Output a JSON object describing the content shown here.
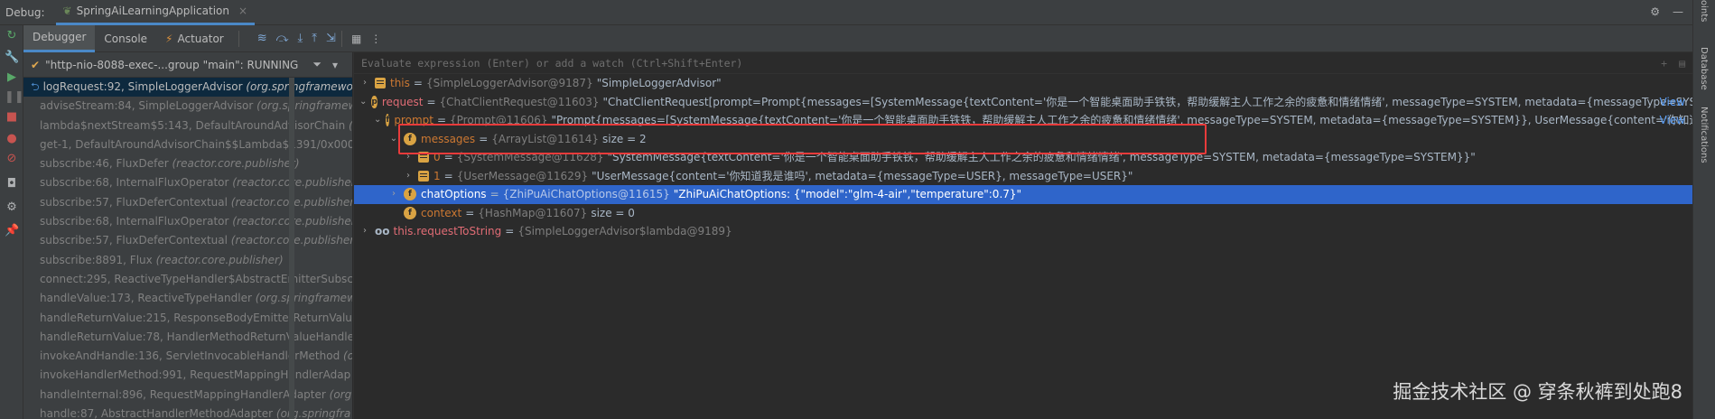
{
  "titlebar": {
    "label": "Debug:",
    "run_tab": "SpringAiLearningApplication",
    "close": "×"
  },
  "tabs": [
    {
      "label": "Debugger"
    },
    {
      "label": "Console"
    },
    {
      "label": "Actuator"
    }
  ],
  "thread": {
    "text": "\"http-nio-8088-exec-...group \"main\": RUNNING"
  },
  "frames": [
    {
      "method": "logRequest:92, SimpleLoggerAdvisor",
      "pkg": "(org.springframewo"
    },
    {
      "method": "adviseStream:84, SimpleLoggerAdvisor",
      "pkg": "(org.springframew"
    },
    {
      "method": "lambda$nextStream$5:143, DefaultAroundAdvisorChain",
      "pkg": "(o"
    },
    {
      "method": "get-1, DefaultAroundAdvisorChain$$Lambda$1391/0x000",
      "pkg": ""
    },
    {
      "method": "subscribe:46, FluxDefer",
      "pkg": "(reactor.core.publisher)"
    },
    {
      "method": "subscribe:68, InternalFluxOperator",
      "pkg": "(reactor.core.publisher"
    },
    {
      "method": "subscribe:57, FluxDeferContextual",
      "pkg": "(reactor.core.publisher)"
    },
    {
      "method": "subscribe:68, InternalFluxOperator",
      "pkg": "(reactor.core.publisher"
    },
    {
      "method": "subscribe:57, FluxDeferContextual",
      "pkg": "(reactor.core.publisher)"
    },
    {
      "method": "subscribe:8891, Flux",
      "pkg": "(reactor.core.publisher)"
    },
    {
      "method": "connect:295, ReactiveTypeHandler$AbstractEmitterSubscr",
      "pkg": ""
    },
    {
      "method": "handleValue:173, ReactiveTypeHandler",
      "pkg": "(org.springframew"
    },
    {
      "method": "handleReturnValue:215, ResponseBodyEmitterReturnValue",
      "pkg": ""
    },
    {
      "method": "handleReturnValue:78, HandlerMethodReturnValueHandle",
      "pkg": ""
    },
    {
      "method": "invokeAndHandle:136, ServletInvocableHandlerMethod",
      "pkg": "(o"
    },
    {
      "method": "invokeHandlerMethod:991, RequestMappingHandlerAdap",
      "pkg": ""
    },
    {
      "method": "handleInternal:896, RequestMappingHandlerAdapter",
      "pkg": "(org"
    },
    {
      "method": "handle:87, AbstractHandlerMethodAdapter",
      "pkg": "(org.springfra"
    }
  ],
  "evaluate": {
    "placeholder": "Evaluate expression (Enter) or add a watch (Ctrl+Shift+Enter)"
  },
  "variables": [
    {
      "name": "this",
      "type": "{SimpleLoggerAdvisor@9187}",
      "value": "\"SimpleLoggerAdvisor\"",
      "view": ""
    },
    {
      "name": "request",
      "type": "{ChatClientRequest@11603}",
      "value": "\"ChatClientRequest[prompt=Prompt{messages=[SystemMessage{textContent='你是一个智能桌面助手铁铁，帮助缓解主人工作之余的疲惫和情绪情绪', messageType=SYSTEM, metadata={messageType=SYST...",
      "view": "View"
    },
    {
      "name": "prompt",
      "type": "{Prompt@11606}",
      "value": "\"Prompt{messages=[SystemMessage{textContent='你是一个智能桌面助手铁铁，帮助缓解主人工作之余的疲惫和情绪情绪', messageType=SYSTEM, metadata={messageType=SYSTEM}}, UserMessage{content='你知道...",
      "view": "View"
    },
    {
      "name": "messages",
      "type": "{ArrayList@11614}",
      "value": "size = 2",
      "view": ""
    },
    {
      "name": "0",
      "type": "{SystemMessage@11628}",
      "value": "\"SystemMessage{textContent='你是一个智能桌面助手铁铁，帮助缓解主人工作之余的疲惫和情绪情绪', messageType=SYSTEM, metadata={messageType=SYSTEM}}\"",
      "view": ""
    },
    {
      "name": "1",
      "type": "{UserMessage@11629}",
      "value": "\"UserMessage{content='你知道我是谁吗', metadata={messageType=USER}, messageType=USER}\"",
      "view": ""
    },
    {
      "name": "chatOptions",
      "type": "{ZhiPuAiChatOptions@11615}",
      "value": "\"ZhiPuAiChatOptions: {\"model\":\"glm-4-air\",\"temperature\":0.7}\"",
      "view": ""
    },
    {
      "name": "context",
      "type": "{HashMap@11607}",
      "value": "size = 0",
      "view": ""
    },
    {
      "name": "this.requestToString",
      "type": "{SimpleLoggerAdvisor$lambda@9189}",
      "value": "",
      "view": ""
    }
  ],
  "rightbar": {
    "top": "oints",
    "database": "Database",
    "notifications": "Notifications"
  },
  "watermark": "掘金技术社区 @ 穿条秋裤到处跑8",
  "colors": {
    "selection": "#2f65ca",
    "highlight_box": "#e83b3b",
    "tab_underline": "#4a88c7"
  }
}
